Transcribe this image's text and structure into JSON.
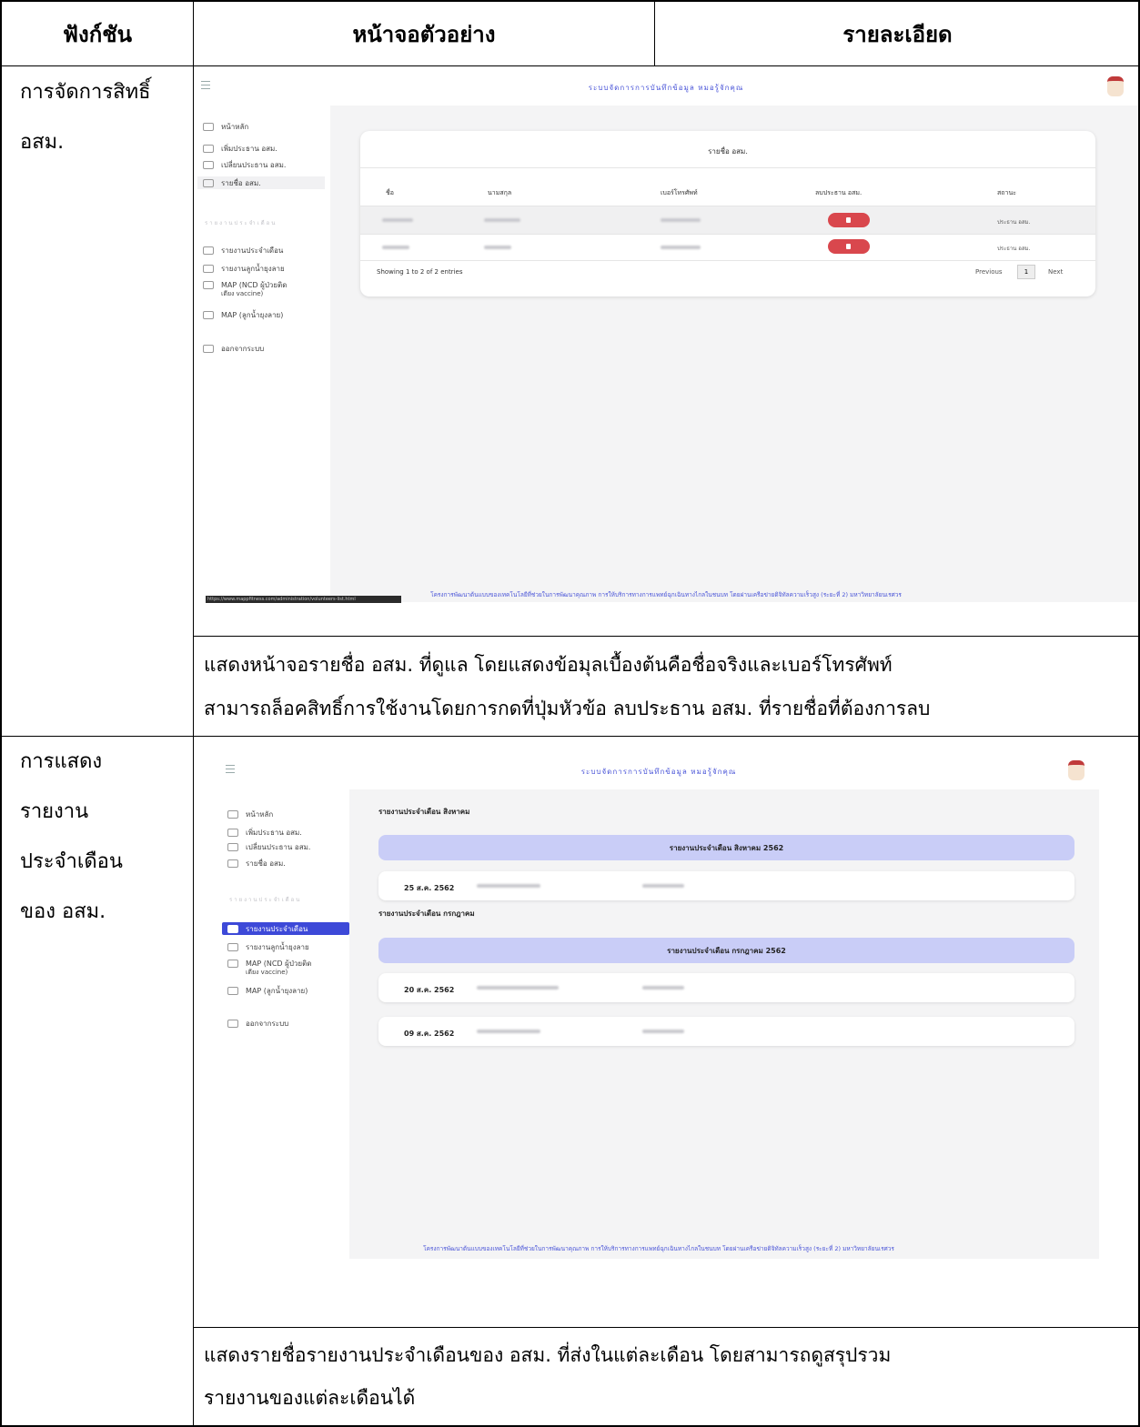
{
  "table": {
    "headers": {
      "function": "ฟังก์ชัน",
      "screen": "หน้าจอตัวอย่าง",
      "detail": "รายละเอียด"
    },
    "rows": [
      {
        "function_lines": [
          "การจัดการสิทธิ์",
          "อสม."
        ],
        "description_lines": [
          "แสดงหน้าจอรายชื่อ อสม. ที่ดูแล โดยแสดงข้อมุลเบื้องต้นคือชื่อจริงและเบอร์โทรศัพท์",
          "สามารถล็อคสิทธิ์การใช้งานโดยการกดที่ปุ่มหัวข้อ ลบประธาน อสม. ที่รายชื่อที่ต้องการลบ"
        ]
      },
      {
        "function_lines": [
          "การแสดง",
          "รายงาน",
          "ประจำเดือน",
          "ของ อสม."
        ],
        "description_lines": [
          "แสดงรายชื่อรายงานประจำเดือนของ อสม. ที่ส่งในแต่ละเดือน โดยสามารถดูสรุปรวม",
          "รายงานของแต่ละเดือนได้"
        ]
      }
    ]
  },
  "app": {
    "title": "ระบบจัดการการบันทึกข้อมูล หมอรู้จักคุณ",
    "sidebar": {
      "items": [
        "หน้าหลัก",
        "เพิ่มประธาน อสม.",
        "เปลี่ยนประธาน อสม.",
        "รายชื่อ อสม."
      ],
      "section": "รายงานประจำเดือน",
      "report_items": [
        "รายงานประจำเดือน",
        "รายงานลูกน้ำยุงลาย",
        "MAP (NCD ผู้ป่วยติด",
        "เตียง vaccine)",
        "MAP (ลูกน้ำยุงลาย)"
      ],
      "logout": "ออกจากระบบ"
    },
    "footer": "โครงการพัฒนาต้นแบบของเทคโนโลยีที่ช่วยในการพัฒนาคุณภาพ การให้บริการทางการแพทย์ฉุกเฉินทางไกลในชนบท โดยผ่านเครือข่ายดิจิทัลความเร็วสูง (ระยะที่ 2) มหาวิทยาลัยนเรศวร",
    "url": "https://www.mappfitness.com/administration/volunteers-list.html"
  },
  "shot1": {
    "card_title": "รายชื่อ อสม.",
    "columns": [
      "ชื่อ",
      "นามสกุล",
      "เบอร์โทรศัพท์",
      "ลบประธาน อสม.",
      "สถานะ"
    ],
    "rows": [
      {
        "status": "ประธาน อสม."
      },
      {
        "status": "ประธาน อสม."
      }
    ],
    "showing": "Showing 1 to 2 of 2 entries",
    "pager": {
      "previous": "Previous",
      "page": "1",
      "next": "Next"
    },
    "colors": {
      "delete": "#d9474d"
    }
  },
  "shot2": {
    "groups": [
      {
        "heading": "รายงานประจำเดือน สิงหาคม",
        "band": "รายงานประจำเดือน สิงหาคม 2562",
        "rows": [
          "25 ส.ค. 2562"
        ]
      },
      {
        "heading": "รายงานประจำเดือน กรกฎาคม",
        "band": "รายงานประจำเดือน กรกฎาคม 2562",
        "rows": [
          "20 ส.ค. 2562",
          "09 ส.ค. 2562"
        ]
      }
    ],
    "colors": {
      "band": "#c9cdf7",
      "accent": "#3d49d8"
    }
  }
}
